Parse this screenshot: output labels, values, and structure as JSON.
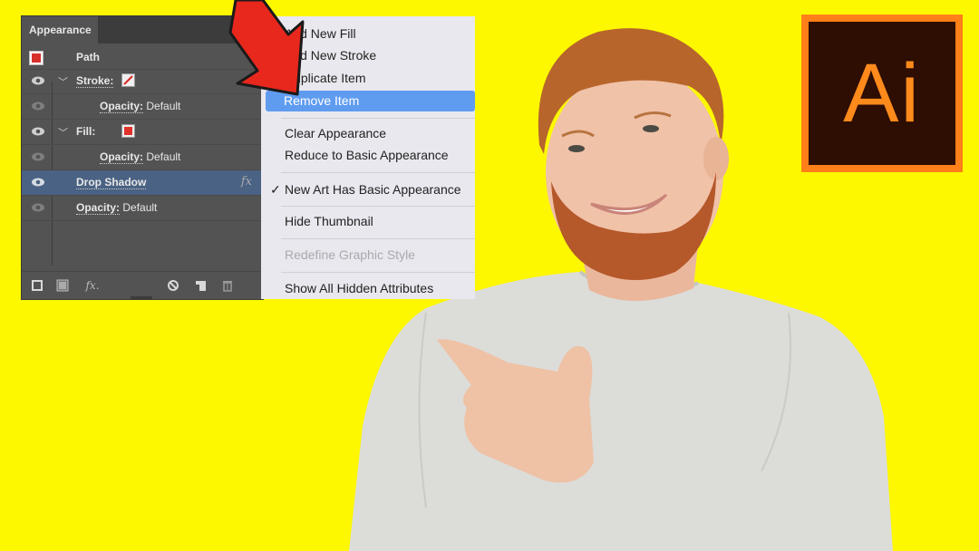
{
  "background_color": "#fdf800",
  "appearance_panel": {
    "tab_label": "Appearance",
    "target_label": "Path",
    "rows": [
      {
        "label": "Stroke:",
        "value": "",
        "kind": "stroke",
        "swatch": "none"
      },
      {
        "label": "Opacity:",
        "value": "Default",
        "kind": "sub"
      },
      {
        "label": "Fill:",
        "value": "",
        "kind": "fill",
        "swatch": "#e0312b"
      },
      {
        "label": "Opacity:",
        "value": "Default",
        "kind": "sub"
      },
      {
        "label": "Drop Shadow",
        "value": "",
        "kind": "effect",
        "badge": "fx",
        "selected": true
      },
      {
        "label": "Opacity:",
        "value": "Default",
        "kind": "top"
      }
    ],
    "footer_icons": [
      "add-stroke-icon",
      "add-fill-icon",
      "fx-icon",
      "clear-appearance-icon",
      "duplicate-item-icon",
      "trash-icon"
    ],
    "footer_fx_label": "fx."
  },
  "context_menu": {
    "groups": [
      [
        {
          "label": "Add New Fill"
        },
        {
          "label": "Add New Stroke"
        },
        {
          "label": "Duplicate Item"
        },
        {
          "label": "Remove Item",
          "highlighted": true
        }
      ],
      [
        {
          "label": "Clear Appearance"
        },
        {
          "label": "Reduce to Basic Appearance"
        }
      ],
      [
        {
          "label": "New Art Has Basic Appearance",
          "checked": true,
          "check_glyph": "✓"
        }
      ],
      [
        {
          "label": "Hide Thumbnail"
        }
      ],
      [
        {
          "label": "Redefine Graphic Style",
          "disabled": true
        }
      ],
      [
        {
          "label": "Show All Hidden Attributes"
        }
      ]
    ],
    "highlight_color": "#5f9cf0"
  },
  "pointer_arrow": {
    "color": "#e8271d",
    "points_to": "Remove Item"
  },
  "logo": {
    "text": "Ai",
    "bg_color": "#2e0e02",
    "accent_color": "#ff7f18"
  },
  "photo": {
    "subject": "smiling red-haired bearded man in light gray sweater pointing left"
  }
}
